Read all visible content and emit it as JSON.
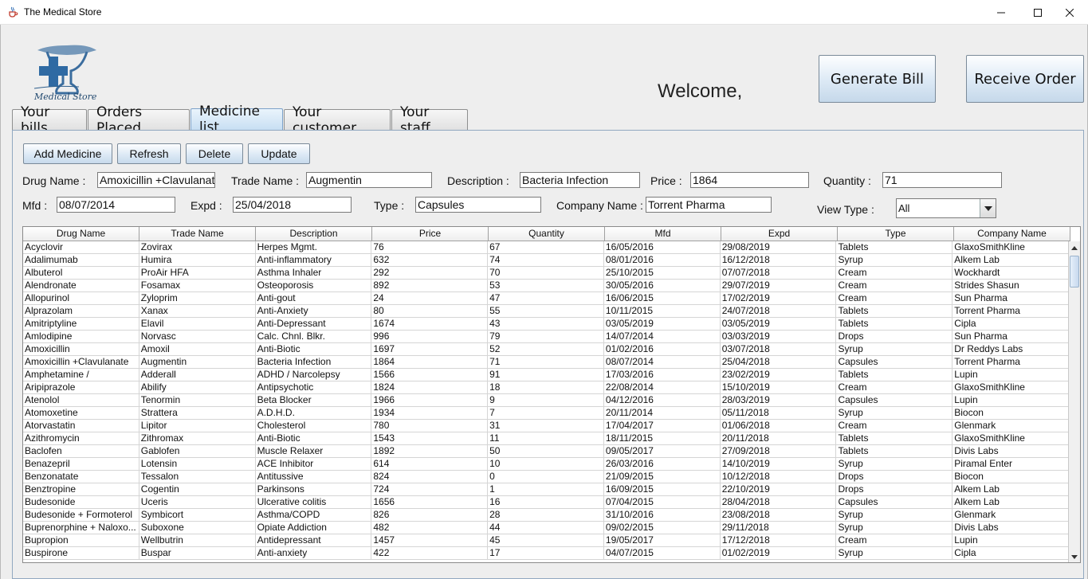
{
  "window": {
    "title": "The Medical Store"
  },
  "logo": {
    "text": "Medical Store"
  },
  "header": {
    "welcome": "Welcome,",
    "generate_bill": "Generate Bill",
    "receive_order": "Receive Order"
  },
  "tabs": [
    {
      "label": "Your bills"
    },
    {
      "label": "Orders Placed"
    },
    {
      "label": "Medicine list"
    },
    {
      "label": "Your customer"
    },
    {
      "label": "Your staff"
    }
  ],
  "active_tab": "Medicine list",
  "toolbar": {
    "add": "Add Medicine",
    "refresh": "Refresh",
    "delete": "Delete",
    "update": "Update"
  },
  "form": {
    "drug_name_label": "Drug Name :",
    "drug_name": "Amoxicillin +Clavulanate",
    "trade_name_label": "Trade Name :",
    "trade_name": "Augmentin",
    "description_label": "Description :",
    "description": "Bacteria Infection",
    "price_label": "Price :",
    "price": "1864",
    "quantity_label": "Quantity :",
    "quantity": "71",
    "mfd_label": "Mfd :",
    "mfd": "08/07/2014",
    "expd_label": "Expd :",
    "expd": "25/04/2018",
    "type_label": "Type :",
    "type": "Capsules",
    "company_label": "Company Name :",
    "company": "Torrent Pharma",
    "view_type_label": "View Type :",
    "view_type": "All"
  },
  "table": {
    "columns": [
      "Drug Name",
      "Trade Name",
      "Description",
      "Price",
      "Quantity",
      "Mfd",
      "Expd",
      "Type",
      "Company Name"
    ],
    "rows": [
      [
        "Acyclovir",
        "Zovirax",
        "Herpes Mgmt.",
        "76",
        "67",
        "16/05/2016",
        "29/08/2019",
        "Tablets",
        "GlaxoSmithKline"
      ],
      [
        "Adalimumab",
        "Humira",
        "Anti-inflammatory",
        "632",
        "74",
        "08/01/2016",
        "16/12/2018",
        "Syrup",
        "Alkem Lab"
      ],
      [
        "Albuterol",
        "ProAir HFA",
        "Asthma Inhaler",
        "292",
        "70",
        "25/10/2015",
        "07/07/2018",
        "Cream",
        "Wockhardt"
      ],
      [
        "Alendronate",
        "Fosamax",
        "Osteoporosis",
        "892",
        "53",
        "30/05/2016",
        "29/07/2019",
        "Cream",
        "Strides Shasun"
      ],
      [
        "Allopurinol",
        "Zyloprim",
        "Anti-gout",
        "24",
        "47",
        "16/06/2015",
        "17/02/2019",
        "Cream",
        "Sun Pharma"
      ],
      [
        "Alprazolam",
        "Xanax",
        "Anti-Anxiety",
        "80",
        "55",
        "10/11/2015",
        "24/07/2018",
        "Tablets",
        "Torrent Pharma"
      ],
      [
        "Amitriptyline",
        "Elavil",
        "Anti-Depressant",
        "1674",
        "43",
        "03/05/2019",
        "03/05/2019",
        "Tablets",
        "Cipla"
      ],
      [
        "Amlodipine",
        "Norvasc",
        "Calc. Chnl. Blkr.",
        "996",
        "79",
        "14/07/2014",
        "03/03/2019",
        "Drops",
        "Sun Pharma"
      ],
      [
        "Amoxicillin",
        "Amoxil",
        "Anti-Biotic",
        "1697",
        "52",
        "01/02/2016",
        "03/07/2018",
        "Syrup",
        "Dr Reddys Labs"
      ],
      [
        "Amoxicillin +Clavulanate",
        "Augmentin",
        "Bacteria Infection",
        "1864",
        "71",
        "08/07/2014",
        "25/04/2018",
        "Capsules",
        "Torrent Pharma"
      ],
      [
        "Amphetamine /",
        "Adderall",
        "ADHD / Narcolepsy",
        "1566",
        "91",
        "17/03/2016",
        "23/02/2019",
        "Tablets",
        "Lupin"
      ],
      [
        "Aripiprazole",
        "Abilify",
        "Antipsychotic",
        "1824",
        "18",
        "22/08/2014",
        "15/10/2019",
        "Cream",
        "GlaxoSmithKline"
      ],
      [
        "Atenolol",
        "Tenormin",
        "Beta Blocker",
        "1966",
        "9",
        "04/12/2016",
        "28/03/2019",
        "Capsules",
        "Lupin"
      ],
      [
        "Atomoxetine",
        "Strattera",
        "A.D.H.D.",
        "1934",
        "7",
        "20/11/2014",
        "05/11/2018",
        "Syrup",
        "Biocon"
      ],
      [
        "Atorvastatin",
        "Lipitor",
        "Cholesterol",
        "780",
        "31",
        "17/04/2017",
        "01/06/2018",
        "Cream",
        "Glenmark"
      ],
      [
        "Azithromycin",
        "Zithromax",
        "Anti-Biotic",
        "1543",
        "11",
        "18/11/2015",
        "20/11/2018",
        "Tablets",
        "GlaxoSmithKline"
      ],
      [
        "Baclofen",
        "Gablofen",
        "Muscle Relaxer",
        "1892",
        "50",
        "09/05/2017",
        "27/09/2018",
        "Tablets",
        "Divis Labs"
      ],
      [
        "Benazepril",
        "Lotensin",
        "ACE Inhibitor",
        "614",
        "10",
        "26/03/2016",
        "14/10/2019",
        "Syrup",
        "Piramal Enter"
      ],
      [
        "Benzonatate",
        "Tessalon",
        "Antitussive",
        "824",
        "0",
        "21/09/2015",
        "10/12/2018",
        "Drops",
        "Biocon"
      ],
      [
        "Benztropine",
        "Cogentin",
        "Parkinsons",
        "724",
        "1",
        "16/09/2015",
        "22/10/2019",
        "Drops",
        "Alkem Lab"
      ],
      [
        "Budesonide",
        "Uceris",
        "Ulcerative colitis",
        "1656",
        "16",
        "07/04/2015",
        "28/04/2018",
        "Capsules",
        "Alkem Lab"
      ],
      [
        "Budesonide + Formoterol",
        "Symbicort",
        "Asthma/COPD",
        "826",
        "28",
        "31/10/2016",
        "23/08/2018",
        "Syrup",
        "Glenmark"
      ],
      [
        "Buprenorphine + Naloxo...",
        "Suboxone",
        "Opiate Addiction",
        "482",
        "44",
        "09/02/2015",
        "29/11/2018",
        "Syrup",
        "Divis Labs"
      ],
      [
        "Bupropion",
        "Wellbutrin",
        "Antidepressant",
        "1457",
        "45",
        "19/05/2017",
        "17/12/2018",
        "Cream",
        "Lupin"
      ],
      [
        "Buspirone",
        "Buspar",
        "Anti-anxiety",
        "422",
        "17",
        "04/07/2015",
        "01/02/2019",
        "Syrup",
        "Cipla"
      ]
    ]
  },
  "colors": {
    "titlebar": "#ffffff",
    "client_bg": "#eeeeee",
    "button_gradient_end": "#c5d8ea",
    "logo_blue": "#3b6d9e"
  },
  "icons": [
    "java-cup-icon",
    "minimize-icon",
    "maximize-icon",
    "close-icon",
    "chevron-down-icon",
    "scroll-up-icon",
    "scroll-down-icon"
  ]
}
